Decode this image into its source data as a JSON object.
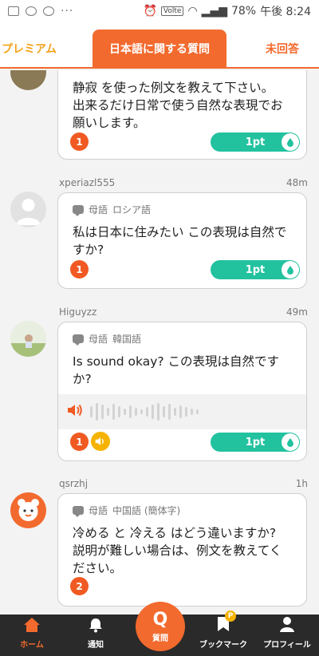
{
  "status_bar": {
    "battery": "78%",
    "time": "午後 8:24",
    "network": "Volte"
  },
  "tabs": [
    {
      "label": "プレミアム"
    },
    {
      "label": "日本語に関する質問"
    },
    {
      "label": "未回答"
    }
  ],
  "questions": [
    {
      "text": [
        "静寂 を使った例文を教えて下さい。",
        "出来るだけ日常で使う自然な表現でお",
        "願いします。"
      ],
      "answers": "1",
      "points": "1pt"
    },
    {
      "username": "xperiazl555",
      "time": "48m",
      "language_prefix": "母語",
      "language": "ロシア語",
      "text": [
        "私は日本に住みたい この表現は自然で",
        "すか?"
      ],
      "answers": "1",
      "points": "1pt"
    },
    {
      "username": "Higuyzz",
      "time": "49m",
      "language_prefix": "母語",
      "language": "韓国語",
      "text": [
        "Is sound okay? この表現は自然です",
        "か?"
      ],
      "answers": "1",
      "points": "1pt"
    },
    {
      "username": "qsrzhj",
      "time": "1h",
      "language_prefix": "母語",
      "language": "中国語 (簡体字)",
      "text": [
        "冷める と 冷える はどう違いますか?",
        "説明が難しい場合は、例文を教えてく",
        "ださい。"
      ],
      "answers": "2"
    }
  ],
  "bottom_nav": {
    "home": "ホーム",
    "notifications": "通知",
    "ask_letter": "Q",
    "ask": "質問",
    "bookmarks": "ブックマーク",
    "bookmark_badge": "P",
    "profile": "プロフィール"
  },
  "colors": {
    "accent": "#f26a2e",
    "premium": "#f5a21b",
    "points": "#22c29f"
  }
}
